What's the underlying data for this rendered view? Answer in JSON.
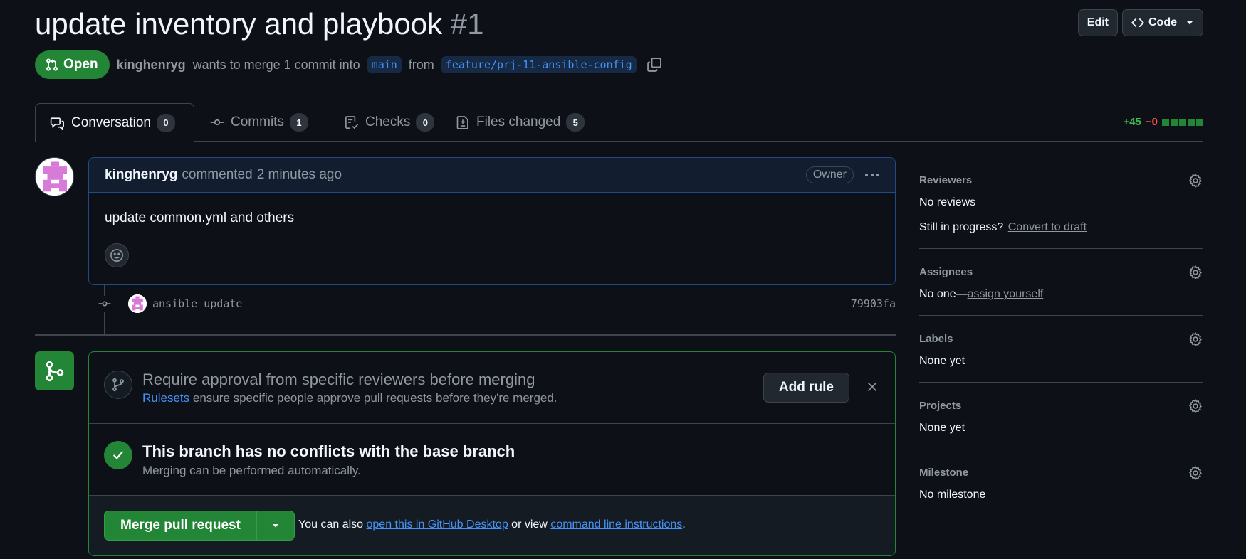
{
  "pr": {
    "title": "update inventory and playbook",
    "number": "#1",
    "state": "Open",
    "author": "kinghenryg",
    "merge_text": "wants to merge 1 commit into",
    "base_branch": "main",
    "from_text": "from",
    "head_branch": "feature/prj-11-ansible-config"
  },
  "header_buttons": {
    "edit": "Edit",
    "code": "Code"
  },
  "tabs": [
    {
      "label": "Conversation",
      "count": "0"
    },
    {
      "label": "Commits",
      "count": "1"
    },
    {
      "label": "Checks",
      "count": "0"
    },
    {
      "label": "Files changed",
      "count": "5"
    }
  ],
  "diffstat": {
    "additions": "+45",
    "deletions": "−0"
  },
  "comment": {
    "author": "kinghenryg",
    "action": "commented",
    "time": "2 minutes ago",
    "role": "Owner",
    "body": "update common.yml and others"
  },
  "commit": {
    "message": "ansible update",
    "sha": "79903fa"
  },
  "merge_box": {
    "rule_title": "Require approval from specific reviewers before merging",
    "rule_link": "Rulesets",
    "rule_sub": "ensure specific people approve pull requests before they're merged.",
    "add_rule": "Add rule",
    "status_title": "This branch has no conflicts with the base branch",
    "status_sub": "Merging can be performed automatically.",
    "merge_button": "Merge pull request",
    "hint_prefix": "You can also",
    "hint_link1": "open this in GitHub Desktop",
    "hint_mid": "or view",
    "hint_link2": "command line instructions",
    "hint_suffix": "."
  },
  "sidebar": {
    "reviewers": {
      "label": "Reviewers",
      "value": "No reviews",
      "progress_q": "Still in progress?",
      "progress_link": "Convert to draft"
    },
    "assignees": {
      "label": "Assignees",
      "value": "No one—",
      "link": "assign yourself"
    },
    "labels": {
      "label": "Labels",
      "value": "None yet"
    },
    "projects": {
      "label": "Projects",
      "value": "None yet"
    },
    "milestone": {
      "label": "Milestone",
      "value": "No milestone"
    }
  },
  "colors": {
    "open_green": "#238636",
    "link_blue": "#4493f8",
    "background": "#0d1117"
  }
}
